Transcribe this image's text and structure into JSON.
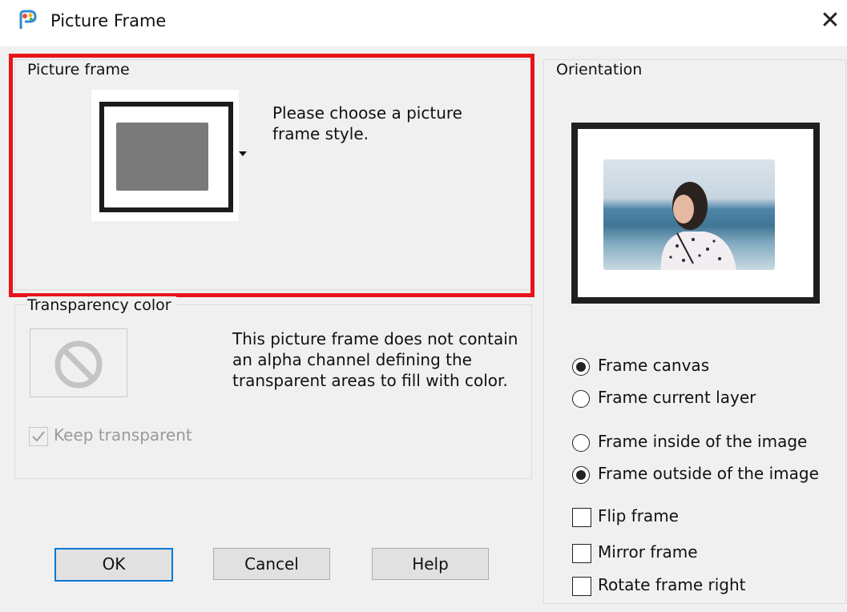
{
  "window": {
    "title": "Picture Frame",
    "close_glyph": "✕",
    "icon": "paintshop-app-icon"
  },
  "picture_frame": {
    "label": "Picture frame",
    "instructions": "Please choose a picture frame style."
  },
  "transparency": {
    "label": "Transparency color",
    "info": "This picture frame does not contain an alpha channel defining the transparent areas to fill with color.",
    "keep_transparent_label": "Keep transparent",
    "keep_transparent_checked": true,
    "keep_transparent_enabled": false
  },
  "orientation": {
    "label": "Orientation",
    "frame_target": [
      {
        "label": "Frame canvas",
        "selected": true
      },
      {
        "label": "Frame current layer",
        "selected": false
      }
    ],
    "frame_position": [
      {
        "label": "Frame inside of the image",
        "selected": false
      },
      {
        "label": "Frame outside of the image",
        "selected": true
      }
    ],
    "options": [
      {
        "label": "Flip frame",
        "checked": false
      },
      {
        "label": "Mirror frame",
        "checked": false
      },
      {
        "label": "Rotate frame right",
        "checked": false
      }
    ]
  },
  "buttons": {
    "ok": "OK",
    "cancel": "Cancel",
    "help": "Help"
  },
  "colors": {
    "highlight": "#e8141a",
    "default_button_border": "#0078d7",
    "dialog_background": "#f0f0f0"
  }
}
